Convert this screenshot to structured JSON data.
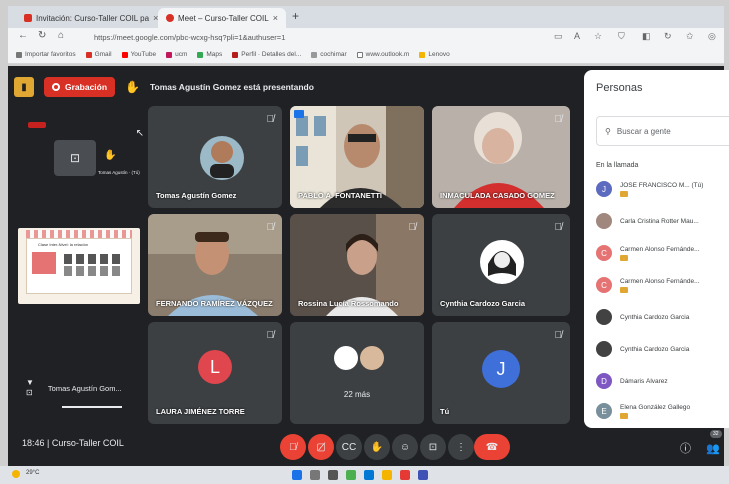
{
  "browser": {
    "tabs": [
      {
        "label": "Invitación: Curso-Taller COIL pa",
        "close": "×"
      },
      {
        "label": "Meet – Curso-Taller COIL",
        "close": "×"
      }
    ],
    "new_tab": "+",
    "url": "https://meet.google.com/pbc-wcxg-hsq?pli=1&authuser=1",
    "bookmarks": [
      "Importar favoritos",
      "Gmail",
      "YouTube",
      "ucm",
      "Maps",
      "Perfil · Detalles del...",
      "cochimar",
      "www.outlook.m",
      "Lenovo"
    ]
  },
  "meet": {
    "recording_label": "Grabación",
    "presenting_text": "Tomas Agustín Gomez está presentando",
    "self_preview_name": "Tomas Agustín · (Tú)",
    "left_presenter_name": "Tomas Agustín Gom...",
    "slide_title": "Clase Inter-Nivel: la relación",
    "tiles": [
      {
        "id": "tomas",
        "name": "Tomas Agustín Gomez",
        "muted": true
      },
      {
        "id": "pablo",
        "name": "PABLO A. FONTANETTI",
        "muted": false
      },
      {
        "id": "inmaculada",
        "name": "INMACULADA CASADO GOMEZ",
        "muted": true
      },
      {
        "id": "fernando",
        "name": "FERNANDO RAMÍREZ VÁZQUEZ",
        "muted": true
      },
      {
        "id": "rossina",
        "name": "Rossina Lucía Rossomando",
        "muted": true
      },
      {
        "id": "cynthia",
        "name": "Cynthia Cardozo Garcia",
        "muted": true
      },
      {
        "id": "laura",
        "name": "LAURA JIMÉNEZ TORRE",
        "initial": "L",
        "muted": true
      },
      {
        "id": "more",
        "name": "22 más"
      },
      {
        "id": "you",
        "name": "Tú",
        "initial": "J",
        "muted": true
      }
    ],
    "bottom": {
      "time": "18:46",
      "separator": "|",
      "meeting_name": "Curso-Taller COIL",
      "people_count": "32"
    }
  },
  "people_panel": {
    "title": "Personas",
    "search_placeholder": "Buscar a gente",
    "section": "En la llamada",
    "people": [
      {
        "name": "JOSE FRANCISCO M... (Tú)",
        "initial": "J",
        "color": "#5c6bc0"
      },
      {
        "name": "Carla Cristina Rotter Mau...",
        "initial": "",
        "color": "#a1887f"
      },
      {
        "name": "Carmen Alonso Fernánde...",
        "initial": "C",
        "color": "#e57373"
      },
      {
        "name": "Carmen Alonso Fernánde...",
        "initial": "C",
        "color": "#e57373"
      },
      {
        "name": "Cynthia Cardozo Garcia",
        "initial": "",
        "color": "#424242"
      },
      {
        "name": "Cynthia Cardozo Garcia",
        "initial": "",
        "color": "#424242"
      },
      {
        "name": "Dámaris Álvarez",
        "initial": "D",
        "color": "#7e57c2"
      },
      {
        "name": "Elena González Gallego",
        "initial": "E",
        "color": "#78909c"
      }
    ]
  },
  "taskbar": {
    "weather": "29°C"
  }
}
